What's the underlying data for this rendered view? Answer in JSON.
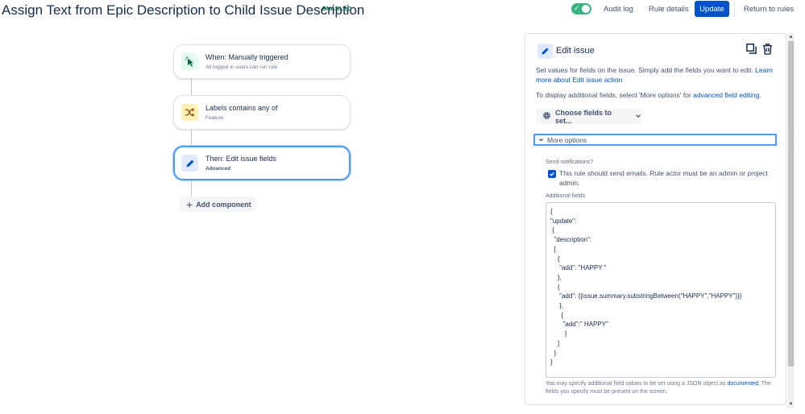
{
  "header": {
    "title": "Assign Text from Epic Description to Child Issue Description",
    "status": "ENABLED",
    "audit_log": "Audit log",
    "rule_details": "Rule details",
    "update": "Update",
    "return_to_rules": "Return to rules",
    "toggle_on": true
  },
  "flow": {
    "nodes": [
      {
        "title": "When: Manually triggered",
        "subtitle": "All logged in users can run rule.",
        "icon": "cursor-click-icon",
        "icon_bg": "#e3fcef",
        "icon_color": "#006644"
      },
      {
        "title": "Labels contains any of",
        "subtitle": "Feature",
        "icon": "shuffle-icon",
        "icon_bg": "#fff0b3",
        "icon_color": "#974f0c"
      },
      {
        "title": "Then: Edit issue fields",
        "subtitle": "Advanced",
        "icon": "pencil-icon",
        "icon_bg": "#deebff",
        "icon_color": "#0052cc",
        "selected": true
      }
    ],
    "add_component": "Add component"
  },
  "panel": {
    "title": "Edit issue",
    "description_prefix": "Set values for fields on the issue. Simply add the fields you want to edit.",
    "description_link": "Learn more about Edit issue action",
    "display_prefix": "To display additional fields, select 'More options' for",
    "display_link": "advanced field editing",
    "display_suffix": ".",
    "choose_fields": "Choose fields to set...",
    "more_options": "More options",
    "send_notifications_label": "Send notifications?",
    "send_notifications_checked": true,
    "send_notifications_text": "This rule should send emails. Rule actor must be an admin or project admin.",
    "additional_fields_label": "Additional fields",
    "additional_fields_lines": [
      "{",
      "\"update\":",
      " {",
      "  \"description\":",
      "  [",
      "    {",
      "     \"add\": \"HAPPY \"",
      "    },",
      "    {",
      "     \"add\": {{issue.summary.substringBetween(\"HAPPY\",\"HAPPY\")}}",
      "     },",
      "      {",
      "       \"add\":\" HAPPY\"",
      "        }",
      "    ]",
      "  }",
      "}"
    ],
    "help_prefix": "You may specify additional field values to be set using a JSON object as",
    "help_link": "documented",
    "help_suffix": ". The fields you specify must be present on the screen."
  }
}
